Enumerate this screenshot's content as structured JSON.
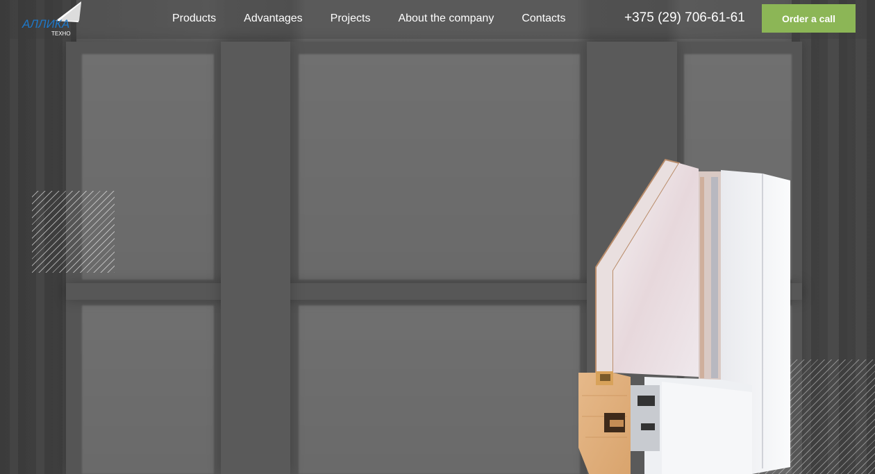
{
  "header": {
    "logo_text": "АЛЛИКА",
    "logo_sub": "ТЕХНО",
    "nav": [
      {
        "label": "Products"
      },
      {
        "label": "Advantages"
      },
      {
        "label": "Projects"
      },
      {
        "label": "About the company"
      },
      {
        "label": "Contacts"
      }
    ],
    "phone": "+375 (29) 706-61-61",
    "cta_label": "Order a call"
  },
  "colors": {
    "accent": "#8cb656",
    "logo_blue": "#1e78c8",
    "nav_text": "#ffffff"
  },
  "icons": {
    "logo": "company-logo",
    "product": "window-profile-cross-section"
  }
}
